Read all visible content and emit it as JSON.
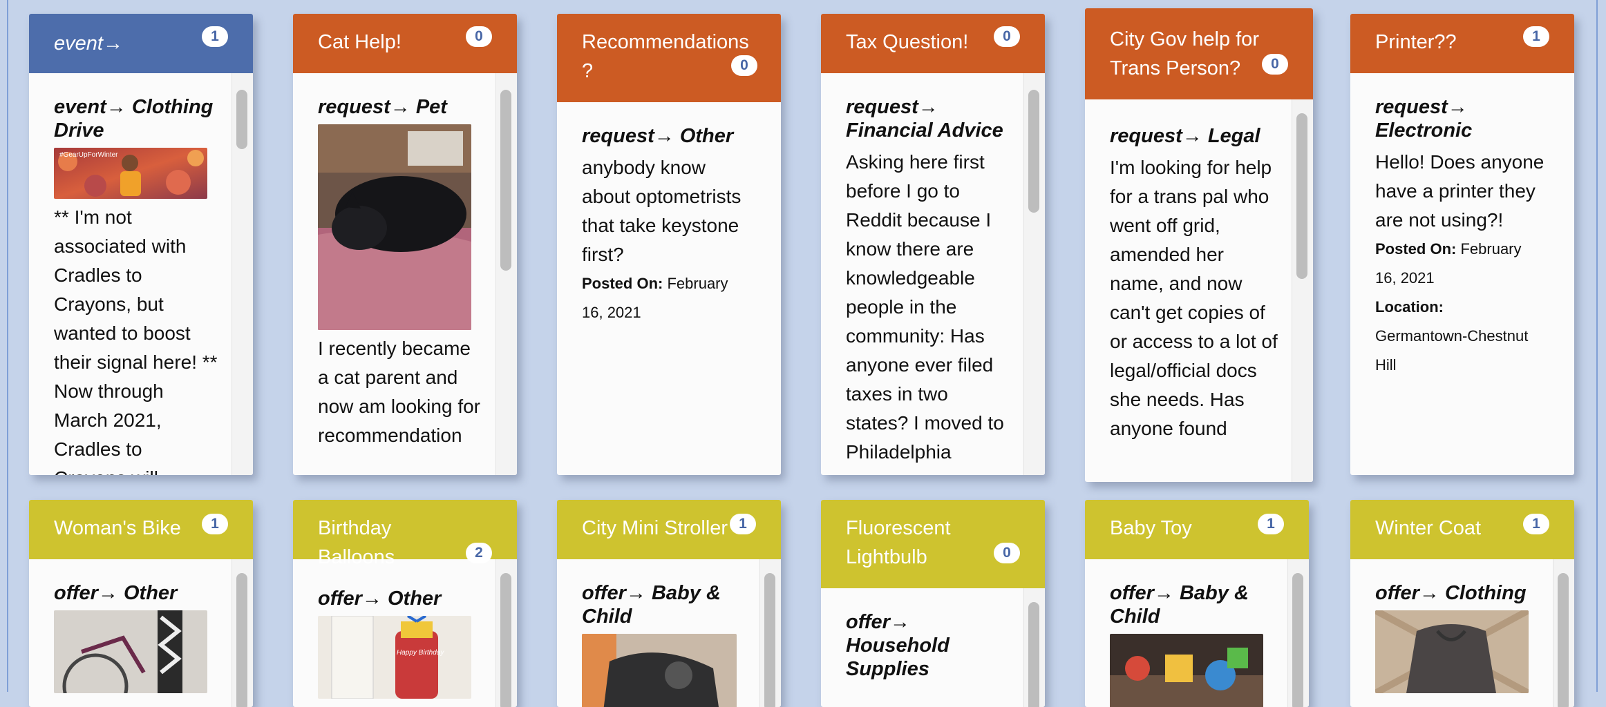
{
  "colors": {
    "event": "#4d6dab",
    "request": "#cc5b23",
    "offer": "#cec32f",
    "background": "#c5d3ea",
    "badge_text": "#4766a6"
  },
  "cards": [
    {
      "title": "event→",
      "count": "1",
      "category": "event→ Clothing Drive",
      "image": "photo-child-in-autumn-leaves",
      "image_caption": "#GearUpForWinter",
      "text": "** I'm not associated with Cradles to Crayons, but wanted to boost their signal here! ** Now through March 2021, Cradles to Crayons will"
    },
    {
      "title": "Cat Help!",
      "count": "0",
      "category": "request→ Pet",
      "image": "photo-black-cat-sleeping",
      "text": "I recently became a cat parent and now am looking for recommendation"
    },
    {
      "title": "Recommendations ?",
      "count": "0",
      "category": "request→ Other",
      "text": "anybody know about optometrists that take keystone first?",
      "posted_label": "Posted On:",
      "posted_value": "February 16, 2021"
    },
    {
      "title": "Tax Question!",
      "count": "0",
      "category": "request→ Financial Advice",
      "text": "Asking here first before I go to Reddit because I know there are knowledgeable people in the community: Has anyone ever filed taxes in two states? I moved to Philadelphia"
    },
    {
      "title": "City Gov help for Trans Person?",
      "count": "0",
      "category": "request→ Legal",
      "text": "I'm looking for help for a trans pal who went off grid, amended her name, and now can't get copies of or access to a lot of legal/official docs she needs. Has anyone found"
    },
    {
      "title": "Printer??",
      "count": "1",
      "category": "request→ Electronic",
      "text": "Hello! Does anyone have a printer they are not using?!",
      "posted_label": "Posted On:",
      "posted_value": "February 16, 2021",
      "location_label": "Location:",
      "location_value": "Germantown-Chestnut Hill"
    },
    {
      "title": "Woman's Bike",
      "count": "1",
      "category": "offer→ Other",
      "image": "photo-bike"
    },
    {
      "title": "Birthday Balloons",
      "count": "2",
      "category": "offer→ Other",
      "image": "photo-birthday-balloon",
      "image_caption": "Happy Birthday"
    },
    {
      "title": "City Mini Stroller",
      "count": "1",
      "category": "offer→ Baby & Child",
      "image": "photo-stroller"
    },
    {
      "title": "Fluorescent Lightbulb",
      "count": "0",
      "category": "offer→ Household Supplies"
    },
    {
      "title": "Baby Toy",
      "count": "1",
      "category": "offer→ Baby & Child",
      "image": "photo-baby-toy"
    },
    {
      "title": "Winter Coat",
      "count": "1",
      "category": "offer→ Clothing",
      "image": "photo-winter-coat"
    }
  ]
}
